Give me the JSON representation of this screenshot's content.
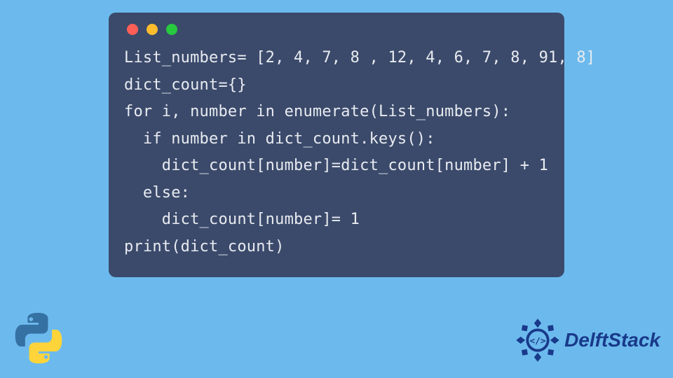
{
  "code_lines": [
    "List_numbers= [2, 4, 7, 8 , 12, 4, 6, 7, 8, 91, 8]",
    "dict_count={}",
    "for i, number in enumerate(List_numbers):",
    "  if number in dict_count.keys():",
    "    dict_count[number]=dict_count[number] + 1",
    "  else:",
    "    dict_count[number]= 1",
    "print(dict_count)"
  ],
  "brand": "DelftStack"
}
